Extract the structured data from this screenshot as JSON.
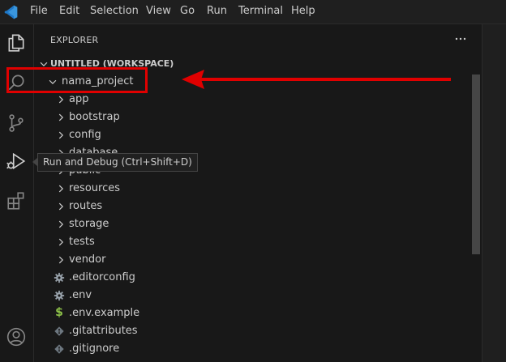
{
  "menu": [
    {
      "label": "File"
    },
    {
      "label": "Edit"
    },
    {
      "label": "Selection"
    },
    {
      "label": "View"
    },
    {
      "label": "Go"
    },
    {
      "label": "Run"
    },
    {
      "label": "Terminal"
    },
    {
      "label": "Help"
    }
  ],
  "activity_bar": {
    "icons": [
      "explorer-icon",
      "search-icon",
      "source-control-icon",
      "run-debug-icon",
      "extensions-icon",
      "account-icon"
    ]
  },
  "sidebar": {
    "title": "EXPLORER",
    "workspace_label": "UNTITLED (WORKSPACE)",
    "project": {
      "label": "nama_project",
      "expanded": true
    },
    "folders": [
      {
        "label": "app"
      },
      {
        "label": "bootstrap"
      },
      {
        "label": "config"
      },
      {
        "label": "database"
      },
      {
        "label": "public"
      },
      {
        "label": "resources"
      },
      {
        "label": "routes"
      },
      {
        "label": "storage"
      },
      {
        "label": "tests"
      },
      {
        "label": "vendor"
      }
    ],
    "files": [
      {
        "label": ".editorconfig",
        "icon": "gear-icon"
      },
      {
        "label": ".env",
        "icon": "gear-icon"
      },
      {
        "label": ".env.example",
        "icon": "dollar-icon",
        "glyph": "$"
      },
      {
        "label": ".gitattributes",
        "icon": "git-icon"
      },
      {
        "label": ".gitignore",
        "icon": "git-icon"
      }
    ]
  },
  "tooltip": {
    "text": "Run and Debug (Ctrl+Shift+D)"
  },
  "colors": {
    "background": "#181818",
    "titlebar": "#1f1f1f",
    "annotation_red": "#e00000",
    "vscode_blue": "#3a96dd",
    "dollar_green": "#8dc149"
  }
}
